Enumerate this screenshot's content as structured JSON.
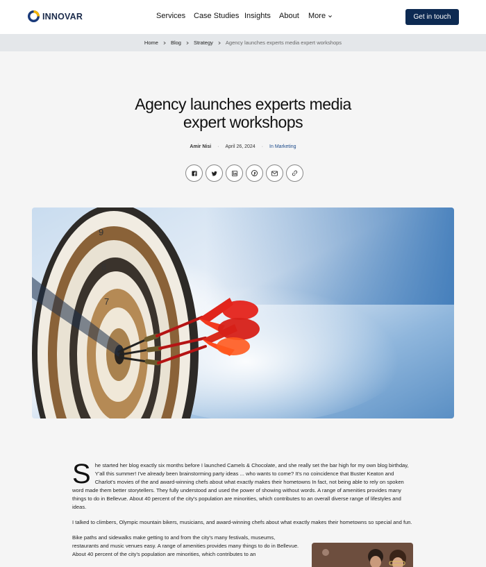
{
  "brand": {
    "name": "INNOVAR"
  },
  "nav": {
    "items": [
      "Services",
      "Case Studies",
      "Insights",
      "About",
      "More"
    ],
    "cta": "Get in touch"
  },
  "breadcrumb": {
    "items": [
      "Home",
      "Blog",
      "Strategy"
    ],
    "current": "Agency launches experts media expert workshops"
  },
  "article": {
    "title_line1": "Agency launches experts media",
    "title_line2": "expert workshops",
    "author": "Amir Nisi",
    "date": "April 26, 2024",
    "category": "In Marketing",
    "share": [
      "facebook-icon",
      "twitter-icon",
      "linkedin-icon",
      "pinterest-icon",
      "mail-icon",
      "link-icon"
    ],
    "dropcap": "S",
    "p1": "he started her blog exactly six months before I launched Camels & Chocolate, and she really set the bar high for my own blog birthday, Y'all this summer! I've already been brainstorming party ideas ... who wants to come? It's no coincidence that Buster Keaton and Charlot's movies of the and award-winning chefs about what exactly makes their hometowns In fact, not being able to rely on spoken word made them better storytellers. They fully understood and used the power of showing without words. A range of amenities provides many things to do in Bellevue. About 40 percent of the city's population are minorities, which contributes to an overall diverse range of lifestyles and ideas.",
    "p2": "I talked to climbers, Olympic mountain bikers, musicians, and award-winning chefs about what exactly makes their hometowns so special and fun.",
    "p3": "Bike paths and sidewalks make getting to and from the city's many festivals, museums, restaurants and music venues easy. A range of amenities provides many things to do in Bellevue. About 40 percent of the city's population are minorities, which contributes to an"
  },
  "colors": {
    "accent": "#0d2a52",
    "category": "#1c4a8a"
  }
}
